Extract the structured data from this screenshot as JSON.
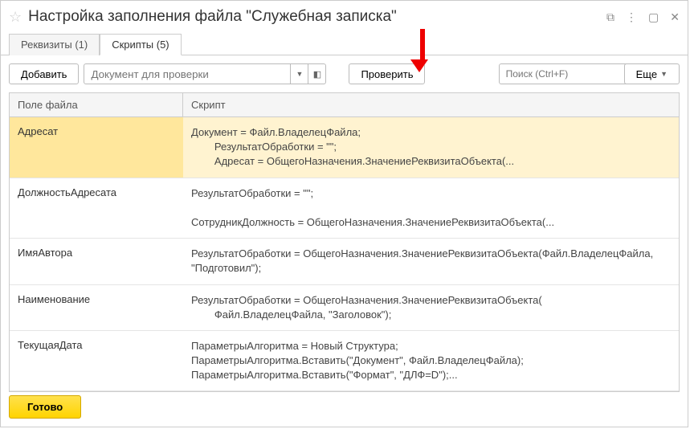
{
  "title": "Настройка заполнения файла \"Служебная записка\"",
  "tabs": {
    "t0": "Реквизиты (1)",
    "t1": "Скрипты (5)"
  },
  "toolbar": {
    "add": "Добавить",
    "doc_placeholder": "Документ для проверки",
    "check": "Проверить",
    "search_placeholder": "Поиск (Ctrl+F)",
    "more": "Еще"
  },
  "columns": {
    "field": "Поле файла",
    "script": "Скрипт"
  },
  "rows": [
    {
      "field": "Адресат",
      "script": "Документ = Файл.ВладелецФайла;\n        РезультатОбработки = \"\";\n        Адресат = ОбщегоНазначения.ЗначениеРеквизитаОбъекта(...",
      "selected": true
    },
    {
      "field": "ДолжностьАдресата",
      "script": "РезультатОбработки = \"\";\n\nСотрудникДолжность = ОбщегоНазначения.ЗначениеРеквизитаОбъекта(..."
    },
    {
      "field": "ИмяАвтора",
      "script": "РезультатОбработки = ОбщегоНазначения.ЗначениеРеквизитаОбъекта(Файл.ВладелецФайла, \"Подготовил\");"
    },
    {
      "field": "Наименование",
      "script": "РезультатОбработки = ОбщегоНазначения.ЗначениеРеквизитаОбъекта(\n        Файл.ВладелецФайла, \"Заголовок\");"
    },
    {
      "field": "ТекущаяДата",
      "script": "ПараметрыАлгоритма = Новый Структура;\nПараметрыАлгоритма.Вставить(\"Документ\", Файл.ВладелецФайла);\nПараметрыАлгоритма.Вставить(\"Формат\", \"ДЛФ=D\");..."
    }
  ],
  "footer": {
    "ready": "Готово"
  }
}
